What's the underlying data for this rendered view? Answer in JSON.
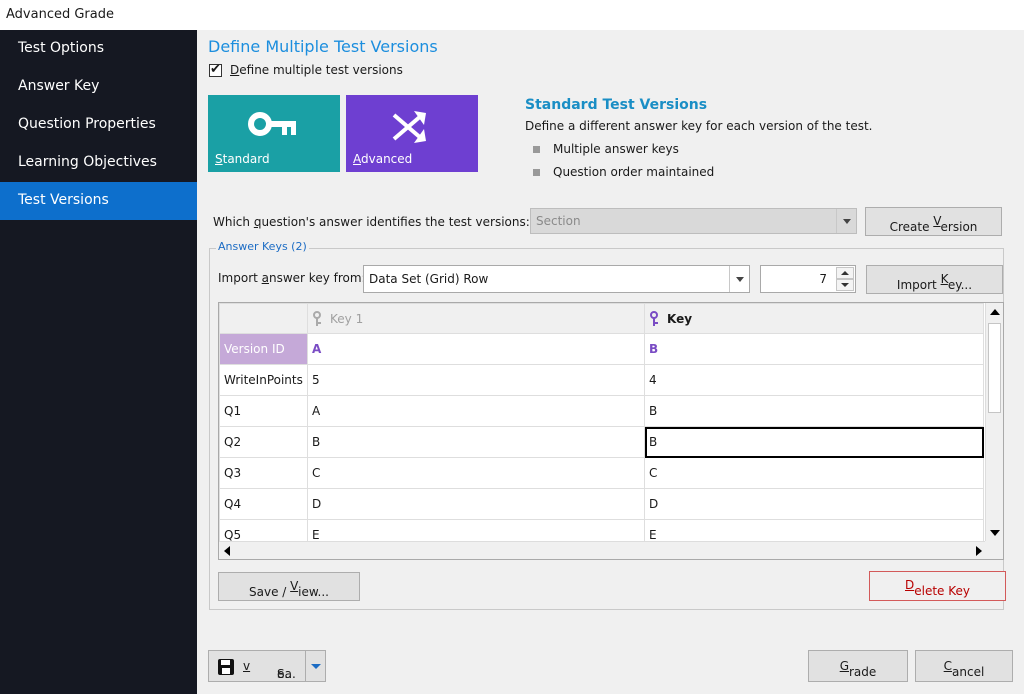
{
  "window": {
    "title": "Advanced Grade"
  },
  "sidebar": {
    "items": [
      {
        "label": "Test Options"
      },
      {
        "label": "Answer Key"
      },
      {
        "label": "Question Properties"
      },
      {
        "label": "Learning Objectives"
      },
      {
        "label": "Test Versions",
        "active": true
      }
    ]
  },
  "main": {
    "heading": "Define Multiple Test Versions",
    "define_checkbox": {
      "accel": "D",
      "rest": "efine multiple test versions",
      "checked": true
    },
    "tiles": {
      "standard": {
        "accel": "S",
        "rest": "tandard",
        "icon": "key-icon"
      },
      "advanced": {
        "accel": "A",
        "rest": "dvanced",
        "icon": "shuffle-icon"
      }
    },
    "info": {
      "title": "Standard Test Versions",
      "description": "Define a different answer key for each version of the test.",
      "bullets": [
        "Multiple answer keys",
        "Question order maintained"
      ]
    },
    "question_selector": {
      "label_pre": "Which ",
      "label_accel": "q",
      "label_post": "uestion's answer identifies the test versions:",
      "value": "Section",
      "create_pre": "Create ",
      "create_accel": "V",
      "create_post": "ersion"
    },
    "answer_keys": {
      "legend": "Answer Keys (2)",
      "import_label_pre": "Import ",
      "import_label_accel": "a",
      "import_label_post": "nswer key from:",
      "import_source": "Data Set (Grid) Row",
      "row_number": "7",
      "import_pre": "Import ",
      "import_accel": "K",
      "import_post": "ey...",
      "grid": {
        "columns": [
          "Key 1",
          "Key"
        ],
        "rows": [
          {
            "label": "Version ID",
            "c1": "A",
            "c2": "B"
          },
          {
            "label": "WriteInPoints",
            "c1": "5",
            "c2": "4"
          },
          {
            "label": "Q1",
            "c1": "A",
            "c2": "B"
          },
          {
            "label": "Q2",
            "c1": "B",
            "c2": "B"
          },
          {
            "label": "Q3",
            "c1": "C",
            "c2": "C"
          },
          {
            "label": "Q4",
            "c1": "D",
            "c2": "D"
          },
          {
            "label": "Q5",
            "c1": "E",
            "c2": "E"
          }
        ]
      },
      "save_view_pre": "Save / ",
      "save_view_accel": "V",
      "save_view_post": "iew...",
      "delete_accel": "D",
      "delete_post": "elete Key"
    },
    "footer": {
      "save_pre": "Sa",
      "save_accel": "v",
      "save_post": "e...",
      "grade_accel": "G",
      "grade_post": "rade",
      "cancel_accel": "C",
      "cancel_post": "ancel"
    }
  },
  "colors": {
    "sidebar_bg": "#151822",
    "sidebar_active": "#0d6fcc",
    "standard_tile": "#1aa0a5",
    "advanced_tile": "#6e3fd1",
    "heading": "#1c8ede",
    "version_id_row": "#c5a9d8",
    "delete_border": "#d35a5a"
  }
}
